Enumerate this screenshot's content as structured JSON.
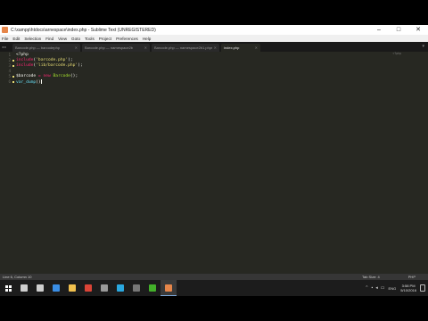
{
  "window": {
    "title": "C:\\xampp\\htdocs\\arnespace\\index.php - Sublime Text (UNREGISTERED)",
    "controls": [
      "–",
      "□",
      "✕"
    ]
  },
  "menu": [
    "File",
    "Edit",
    "Selection",
    "Find",
    "View",
    "Goto",
    "Tools",
    "Project",
    "Preferences",
    "Help"
  ],
  "tabs": [
    {
      "label": "Barcode.php — barcodephp",
      "active": false
    },
    {
      "label": "Barcode.php — namespace2b",
      "active": false
    },
    {
      "label": "Barcode.php — namespace2b1.phpsec",
      "active": false
    },
    {
      "label": "index.php",
      "active": true
    }
  ],
  "nav_arrows": "◂ ▸",
  "tab_menu": "▾",
  "editor": {
    "line_numbers": [
      "1",
      "2",
      "3",
      "4",
      "5",
      "6"
    ],
    "lines": {
      "l1": {
        "text": "<?php"
      },
      "l2": {
        "kw": "include",
        "open": "(",
        "str": "'barcode.php'",
        "close": ");"
      },
      "l3": {
        "kw": "include",
        "open": "(",
        "str": "'lib/barcode.php'",
        "close": ");"
      },
      "l5": {
        "var": "$barcode",
        "eq": " = ",
        "new": "new",
        "cls": " Barcode",
        "close": "();"
      },
      "l6": {
        "fn": "var_dump",
        "close": "()"
      }
    },
    "minimap_text": "<?php"
  },
  "status": {
    "left": "Line 6, Column 10",
    "tab_size": "Tab Size: 4",
    "syntax": "PHP"
  },
  "taskbar": {
    "items": [
      {
        "name": "search-icon",
        "color": "#cfcfcf"
      },
      {
        "name": "task-view-icon",
        "color": "#cfcfcf"
      },
      {
        "name": "edge-icon",
        "color": "#3a8ee6"
      },
      {
        "name": "file-explorer-icon",
        "color": "#f2c14e"
      },
      {
        "name": "chrome-icon",
        "color": "#db4437"
      },
      {
        "name": "settings-icon",
        "color": "#9a9a9a"
      },
      {
        "name": "skype-icon",
        "color": "#2aa8e0"
      },
      {
        "name": "app-icon",
        "color": "#777777"
      },
      {
        "name": "camtasia-icon",
        "color": "#43b02a"
      },
      {
        "name": "sublime-text-icon",
        "color": "#e6864a"
      }
    ],
    "lang": "ENG",
    "time": "3:58 PM",
    "date": "5/10/2016"
  }
}
